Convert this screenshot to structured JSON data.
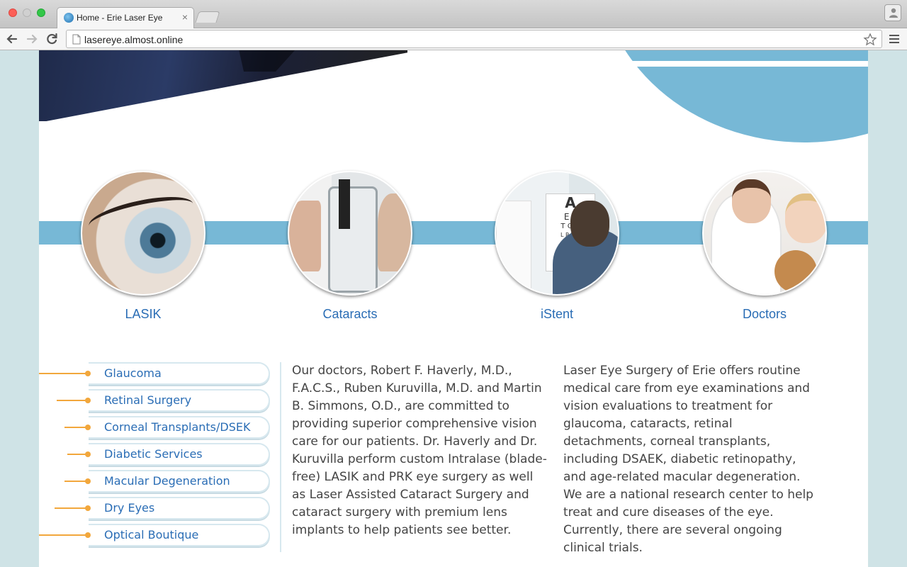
{
  "browser": {
    "tab_title": "Home - Erie Laser Eye",
    "tab_close": "×",
    "url": "lasereye.almost.online"
  },
  "features": [
    {
      "label": "LASIK",
      "icon": "eye-closeup-image"
    },
    {
      "label": "Cataracts",
      "icon": "slit-lamp-exam-image"
    },
    {
      "label": "iStent",
      "icon": "eye-chart-exam-image"
    },
    {
      "label": "Doctors",
      "icon": "doctor-with-child-image"
    }
  ],
  "eye_chart": {
    "letters": [
      "A",
      "E F",
      "T O Z",
      "L P E D",
      "· · · ·",
      "· · · · ·"
    ]
  },
  "side_nav": [
    {
      "label": "Glaucoma"
    },
    {
      "label": "Retinal Surgery"
    },
    {
      "label": "Corneal Transplants/DSEK"
    },
    {
      "label": "Diabetic Services"
    },
    {
      "label": "Macular Degeneration"
    },
    {
      "label": "Dry Eyes"
    },
    {
      "label": "Optical Boutique"
    }
  ],
  "content": {
    "col1": "Our doctors, Robert F. Haverly, M.D., F.A.C.S., Ruben Kuruvilla, M.D. and Martin B. Simmons, O.D., are committed to providing superior comprehensive vision care for our patients. Dr. Haverly and Dr. Kuruvilla perform custom Intralase (blade-free) LASIK and PRK eye surgery as well as Laser Assisted Cataract Surgery and cataract surgery with premium lens implants to help patients see better.",
    "col2": "Laser Eye Surgery of Erie offers routine medical care from eye examinations and vision evaluations to treatment for glaucoma, cataracts, retinal detachments, corneal transplants, including DSAEK, diabetic retinopathy, and age-related macular degeneration. We are a national research center to help treat and cure diseases of the eye. Currently, there are several ongoing clinical trials."
  },
  "colors": {
    "accent_blue": "#77b8d6",
    "link_blue": "#2a6db5",
    "nav_orange": "#f2a73c"
  }
}
